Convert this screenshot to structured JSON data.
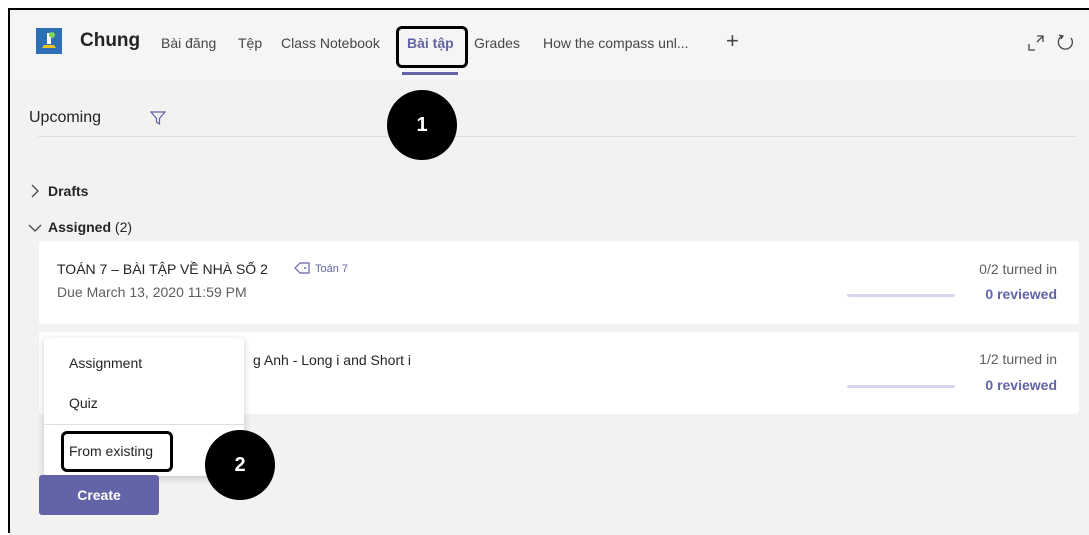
{
  "header": {
    "team_name": "Chung",
    "tabs": [
      {
        "label": "Bài đăng"
      },
      {
        "label": "Tệp"
      },
      {
        "label": "Class Notebook"
      },
      {
        "label": "Bài tập"
      },
      {
        "label": "Grades"
      },
      {
        "label": "How the compass unl..."
      }
    ],
    "active_tab": "Bài tập",
    "add_tab_label": "+"
  },
  "filter": {
    "label": "Upcoming"
  },
  "sections": {
    "drafts": {
      "label": "Drafts"
    },
    "assigned": {
      "label": "Assigned",
      "count": "(2)"
    }
  },
  "assignments": [
    {
      "title": "TOÁN 7 – BÀI TẬP VỀ NHÀ SỐ 2",
      "tag": "Toán 7",
      "due": "Due March 13, 2020 11:59 PM",
      "turned_in": "0/2 turned in",
      "reviewed": "0 reviewed"
    },
    {
      "title": "g Anh - Long i and Short i",
      "turned_in": "1/2 turned in",
      "reviewed": "0 reviewed"
    }
  ],
  "create_menu": {
    "items": [
      {
        "label": "Assignment"
      },
      {
        "label": "Quiz"
      },
      {
        "label": "From existing"
      }
    ]
  },
  "create_button": {
    "label": "Create"
  },
  "callouts": [
    {
      "label": "1"
    },
    {
      "label": "2"
    }
  ],
  "colors": {
    "accent": "#6264a7",
    "callout": "#000000"
  }
}
